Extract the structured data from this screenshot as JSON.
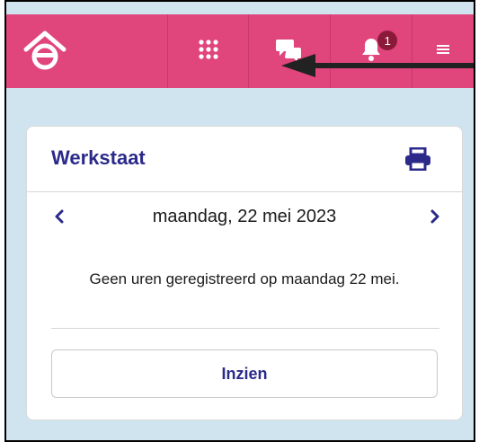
{
  "header": {
    "home_icon": "home-logo-icon",
    "apps_icon": "grid-dots-icon",
    "chat_icon": "chat-bubbles-icon",
    "notifications_icon": "bell-icon",
    "notification_count": "1",
    "menu_icon": "hamburger-menu-icon",
    "colors": {
      "bar": "#e0457c",
      "badge": "#8b1a3a",
      "background": "#cfe4ee",
      "accent": "#2b2a8a"
    }
  },
  "card": {
    "title": "Werkstaat",
    "print_icon": "printer-icon",
    "prev_icon": "chevron-left-icon",
    "next_icon": "chevron-right-icon",
    "date": "maandag, 22 mei 2023",
    "empty_message": "Geen uren geregistreerd op maandag 22 mei.",
    "view_button_label": "Inzien"
  }
}
